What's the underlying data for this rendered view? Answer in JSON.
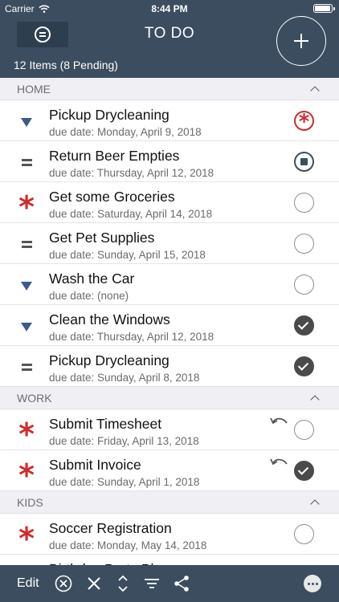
{
  "status_bar": {
    "carrier": "Carrier",
    "time": "8:44 PM"
  },
  "header": {
    "title": "TO DO",
    "count": "12 Items (8 Pending)"
  },
  "sections": [
    {
      "label": "HOME",
      "items": [
        {
          "title": "Pickup Drycleaning",
          "due": "due date: Monday, April 9, 2018",
          "priority": "low",
          "status": "urgent"
        },
        {
          "title": "Return Beer Empties",
          "due": "due date: Thursday, April 12, 2018",
          "priority": "medium",
          "status": "stop"
        },
        {
          "title": "Get some Groceries",
          "due": "due date: Saturday, April 14, 2018",
          "priority": "high",
          "status": "open"
        },
        {
          "title": "Get Pet Supplies",
          "due": "due date: Sunday, April 15, 2018",
          "priority": "medium",
          "status": "open"
        },
        {
          "title": "Wash the Car",
          "due": "due date: (none)",
          "priority": "low",
          "status": "open"
        },
        {
          "title": "Clean the Windows",
          "due": "due date: Thursday, April 12, 2018",
          "priority": "low",
          "status": "done"
        },
        {
          "title": "Pickup Drycleaning",
          "due": "due date: Sunday, April 8, 2018",
          "priority": "medium",
          "status": "done"
        }
      ]
    },
    {
      "label": "WORK",
      "items": [
        {
          "title": "Submit Timesheet",
          "due": "due date: Friday, April 13, 2018",
          "priority": "high",
          "status": "open",
          "repeat": true
        },
        {
          "title": "Submit Invoice",
          "due": "due date: Sunday, April 1, 2018",
          "priority": "high",
          "status": "done",
          "repeat": true
        }
      ]
    },
    {
      "label": "KIDS",
      "items": [
        {
          "title": "Soccer Registration",
          "due": "due date: Monday, May 14, 2018",
          "priority": "high",
          "status": "open"
        },
        {
          "title": "Birthday Party Plans",
          "due": "",
          "priority": "high",
          "status": "done"
        }
      ]
    }
  ],
  "toolbar": {
    "edit_label": "Edit"
  },
  "colors": {
    "header": "#3b4d5e",
    "priority_high": "#d12b2b",
    "priority_low": "#3a5a8c"
  },
  "icons": [
    "menu-icon",
    "add-icon",
    "clear-icon",
    "close-icon",
    "expand-collapse-icon",
    "filter-icon",
    "share-icon",
    "more-icon",
    "repeat-icon"
  ]
}
